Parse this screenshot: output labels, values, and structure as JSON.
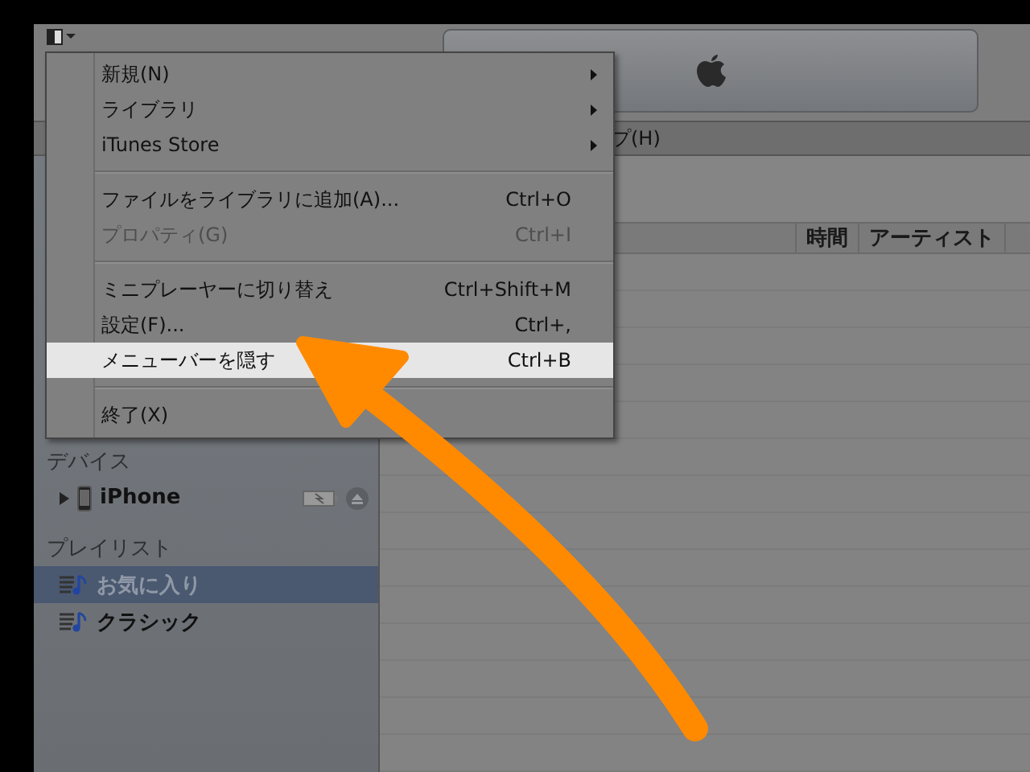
{
  "menu_bar": {
    "items": [
      "プ(H)"
    ]
  },
  "menu": {
    "items": [
      {
        "kind": "item",
        "label": "新規(N)",
        "submenu": true,
        "disabled": false,
        "selected": false
      },
      {
        "kind": "item",
        "label": "ライブラリ",
        "submenu": true,
        "disabled": false,
        "selected": false
      },
      {
        "kind": "item",
        "label": "iTunes Store",
        "submenu": true,
        "disabled": false,
        "selected": false
      },
      {
        "kind": "separator"
      },
      {
        "kind": "item",
        "label": "ファイルをライブラリに追加(A)...",
        "shortcut": "Ctrl+O",
        "submenu": false,
        "disabled": false,
        "selected": false
      },
      {
        "kind": "item",
        "label": "プロパティ(G)",
        "shortcut": "Ctrl+I",
        "submenu": false,
        "disabled": true,
        "selected": false
      },
      {
        "kind": "separator"
      },
      {
        "kind": "item",
        "label": "ミニプレーヤーに切り替え",
        "shortcut": "Ctrl+Shift+M",
        "submenu": false,
        "disabled": false,
        "selected": false
      },
      {
        "kind": "item",
        "label": "設定(F)...",
        "shortcut": "Ctrl+,",
        "submenu": false,
        "disabled": false,
        "selected": false
      },
      {
        "kind": "item",
        "label": "メニューバーを隠す",
        "shortcut": "Ctrl+B",
        "submenu": false,
        "disabled": false,
        "selected": true
      },
      {
        "kind": "separator"
      },
      {
        "kind": "item",
        "label": "終了(X)",
        "submenu": false,
        "disabled": false,
        "selected": false
      }
    ]
  },
  "sidebar": {
    "sections": [
      {
        "heading": "デバイス",
        "items": [
          {
            "kind": "device",
            "label": "iPhone",
            "selected": false
          }
        ]
      },
      {
        "heading": "プレイリスト",
        "items": [
          {
            "kind": "playlist",
            "label": "お気に入り",
            "selected": true
          },
          {
            "kind": "playlist",
            "label": "クラシック",
            "selected": false
          }
        ]
      }
    ]
  },
  "table": {
    "columns": [
      "時間",
      "アーティスト"
    ]
  }
}
